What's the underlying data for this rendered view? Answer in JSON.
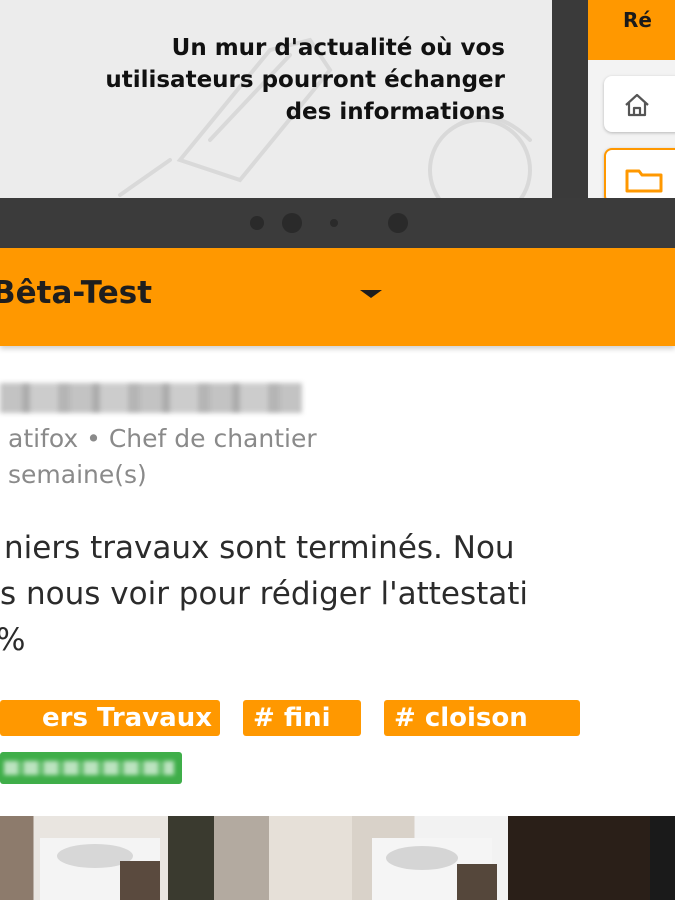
{
  "banner": {
    "lines": [
      "Un mur d'actualité où vos",
      "utilisateurs pourront échanger",
      "des informations"
    ]
  },
  "mini_app": {
    "header_text": "Ré",
    "items": [
      {
        "icon": "home-icon"
      },
      {
        "icon": "folder-icon"
      }
    ]
  },
  "app_header": {
    "title": "Bêta-Test",
    "dropdown_icon": "caret-down-icon"
  },
  "post": {
    "author_role": "atifox • Chef de chantier",
    "date": "semaine(s)",
    "text_lines": [
      "niers travaux sont terminés. Nou",
      "s nous voir pour rédiger l'attestati",
      "%"
    ],
    "tags": [
      "ers Travaux",
      "# fini",
      "# cloison"
    ]
  },
  "colors": {
    "accent": "#ff9800",
    "device_frame": "#3b3b3b",
    "green_chip": "#3fae49",
    "secondary_text": "#8a8a8a"
  }
}
